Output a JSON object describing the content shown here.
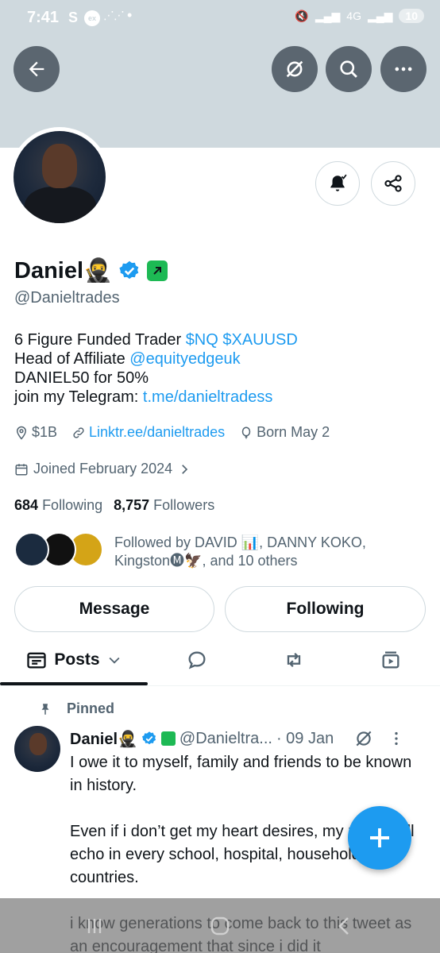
{
  "status_bar": {
    "time": "7:41",
    "s_icon": "S",
    "ex_icon": "ex",
    "signal_text": "4G",
    "battery": "10"
  },
  "profile": {
    "name": "Daniel🥷",
    "handle": "@Danieltrades",
    "bio": {
      "line1_text": "6 Figure Funded Trader ",
      "line1_link": "$NQ $XAUUSD",
      "line2_text": "Head of Affiliate ",
      "line2_link": "@equityedgeuk",
      "line3_text": "DANIEL50 for 50%",
      "line4_text": "join my Telegram: ",
      "line4_link": "t.me/danieltradess"
    },
    "location": "$1B",
    "website": "Linktr.ee/danieltrades",
    "born": "Born May 2",
    "joined": "Joined February 2024",
    "following_count": "684",
    "following_label": "Following",
    "followers_count": "8,757",
    "followers_label": "Followers",
    "followed_by": "Followed by DAVID 📊, DANNY KOKO, Kingston🅜🦅, and 10 others"
  },
  "buttons": {
    "message": "Message",
    "following": "Following"
  },
  "tabs": {
    "posts": "Posts"
  },
  "pinned_label": "Pinned",
  "post": {
    "name": "Daniel🥷",
    "handle": "@Danieltra...",
    "date": "· 09 Jan",
    "text": "I owe it to myself, family and friends to be known in history.\n\nEven if i don’t get my heart desires, my name will echo in every school, hospital, household and countries.\n\ni know generations to come back to this tweet as an encouragement that since i did it"
  },
  "colors": {
    "accent": "#1d9bf0",
    "banner": "#cfd9de",
    "text": "#0f1419",
    "muted": "#536471"
  }
}
